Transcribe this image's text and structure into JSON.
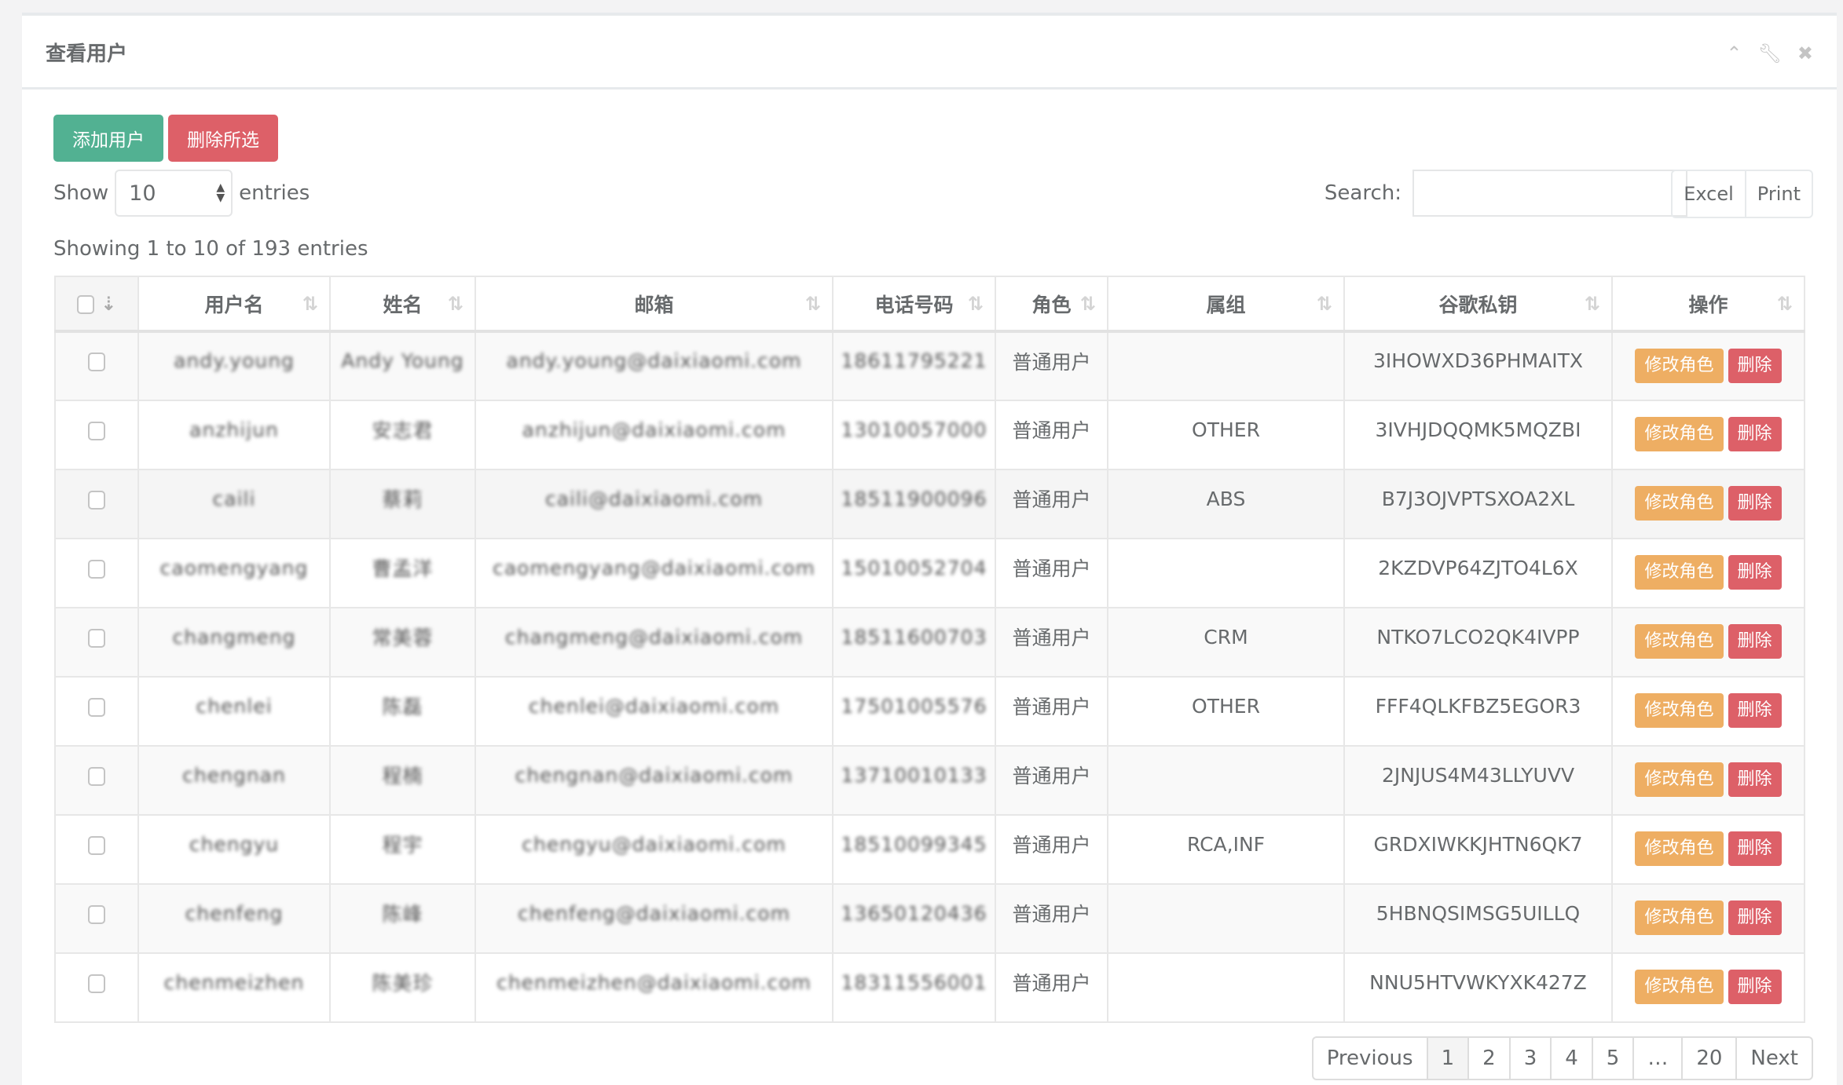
{
  "panel": {
    "title": "查看用户",
    "icons": [
      "chevron-up-icon",
      "wrench-icon",
      "close-icon"
    ]
  },
  "toolbar": {
    "add_label": "添加用户",
    "delete_selected_label": "删除所选"
  },
  "length": {
    "show": "Show",
    "value": "10",
    "entries": "entries"
  },
  "search": {
    "label": "Search:",
    "value": "",
    "placeholder": ""
  },
  "export": {
    "excel": "Excel",
    "print": "Print"
  },
  "info": "Showing 1 to 10 of 193 entries",
  "columns": [
    "用户名",
    "姓名",
    "邮箱",
    "电话号码",
    "角色",
    "属组",
    "谷歌私钥",
    "操作"
  ],
  "rows": [
    {
      "username": "andy.young",
      "name": "Andy Young",
      "email": "andy.young@daixiaomi.com",
      "phone": "18611795221",
      "role": "普通用户",
      "group": "",
      "key": "3IHOWXD36PHMAITX"
    },
    {
      "username": "anzhijun",
      "name": "安志君",
      "email": "anzhijun@daixiaomi.com",
      "phone": "13010057000",
      "role": "普通用户",
      "group": "OTHER",
      "key": "3IVHJDQQMK5MQZBI"
    },
    {
      "username": "caili",
      "name": "蔡莉",
      "email": "caili@daixiaomi.com",
      "phone": "18511900096",
      "role": "普通用户",
      "group": "ABS",
      "key": "B7J3OJVPTSXOA2XL"
    },
    {
      "username": "caomengyang",
      "name": "曹孟洋",
      "email": "caomengyang@daixiaomi.com",
      "phone": "15010052704",
      "role": "普通用户",
      "group": "",
      "key": "2KZDVP64ZJTO4L6X"
    },
    {
      "username": "changmeng",
      "name": "常美蓉",
      "email": "changmeng@daixiaomi.com",
      "phone": "18511600703",
      "role": "普通用户",
      "group": "CRM",
      "key": "NTKO7LCO2QK4IVPP"
    },
    {
      "username": "chenlei",
      "name": "陈磊",
      "email": "chenlei@daixiaomi.com",
      "phone": "17501005576",
      "role": "普通用户",
      "group": "OTHER",
      "key": "FFF4QLKFBZ5EGOR3"
    },
    {
      "username": "chengnan",
      "name": "程楠",
      "email": "chengnan@daixiaomi.com",
      "phone": "13710010133",
      "role": "普通用户",
      "group": "",
      "key": "2JNJUS4M43LLYUVV"
    },
    {
      "username": "chengyu",
      "name": "程宇",
      "email": "chengyu@daixiaomi.com",
      "phone": "18510099345",
      "role": "普通用户",
      "group": "RCA,INF",
      "key": "GRDXIWKKJHTN6QK7"
    },
    {
      "username": "chenfeng",
      "name": "陈峰",
      "email": "chenfeng@daixiaomi.com",
      "phone": "13650120436",
      "role": "普通用户",
      "group": "",
      "key": "5HBNQSIMSG5UILLQ"
    },
    {
      "username": "chenmeizhen",
      "name": "陈美珍",
      "email": "chenmeizhen@daixiaomi.com",
      "phone": "18311556001",
      "role": "普通用户",
      "group": "",
      "key": "NNU5HTVWKYXK427Z"
    }
  ],
  "actions": {
    "edit_role": "修改角色",
    "delete": "删除"
  },
  "pagination": {
    "previous": "Previous",
    "pages": [
      "1",
      "2",
      "3",
      "4",
      "5",
      "…",
      "20"
    ],
    "current": "1",
    "next": "Next"
  },
  "colors": {
    "add": "#52b192",
    "danger": "#dd6068",
    "warning": "#eeae63"
  }
}
